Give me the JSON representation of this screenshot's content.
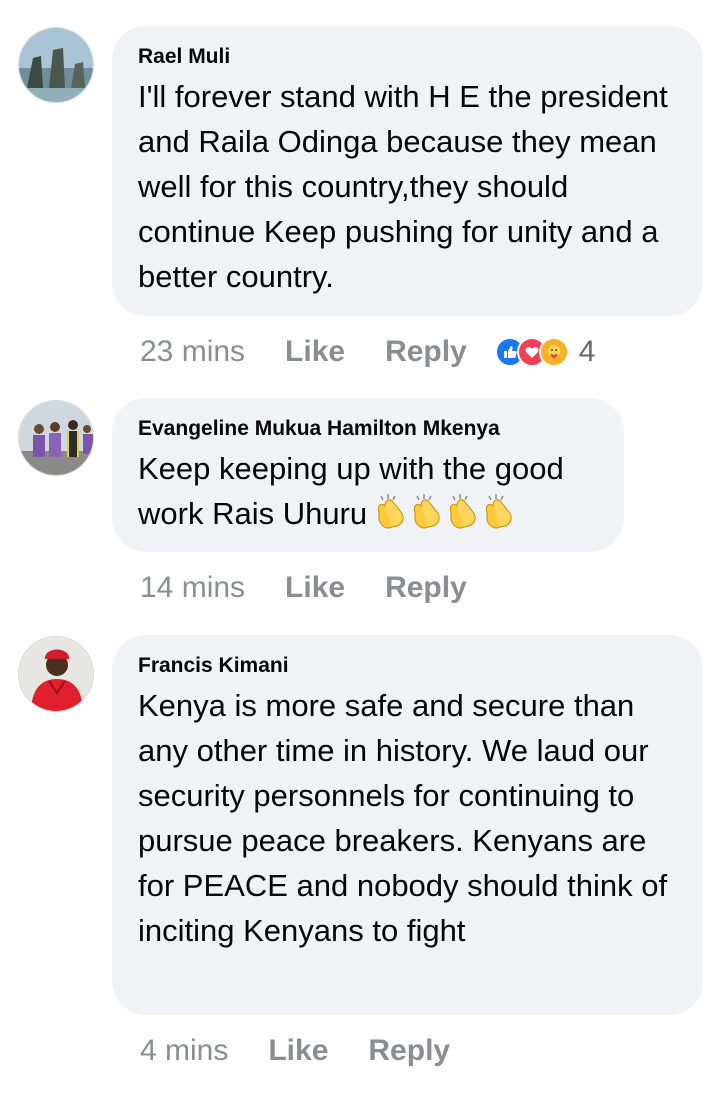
{
  "comments": [
    {
      "author": "Rael Muli",
      "text": "I'll forever stand with H E the president and Raila Odinga because they mean well for this country,they should continue Keep pushing for unity and a better country.",
      "time": "23 mins",
      "like_label": "Like",
      "reply_label": "Reply",
      "reactions": {
        "icons": [
          "like-icon",
          "love-icon",
          "care-icon"
        ],
        "count": "4"
      }
    },
    {
      "author": "Evangeline Mukua Hamilton Mkenya",
      "text": "Keep keeping up with the good work  Rais Uhuru",
      "emoji": [
        "clapping-hands-emoji",
        "clapping-hands-emoji",
        "clapping-hands-emoji",
        "clapping-hands-emoji"
      ],
      "time": "14 mins",
      "like_label": "Like",
      "reply_label": "Reply"
    },
    {
      "author": "Francis Kimani",
      "text": "Kenya is more safe and secure than any other time in history. We laud our security personnels for continuing to pursue peace breakers. Kenyans are for PEACE and nobody should think of inciting Kenyans to fight",
      "time": "4 mins",
      "like_label": "Like",
      "reply_label": "Reply"
    }
  ],
  "colors": {
    "bubble": "#f0f2f5",
    "meta_text": "#8a8d91",
    "like_blue": "#1877f2",
    "love_red": "#f33e58",
    "care_yellow": "#f7b125"
  }
}
